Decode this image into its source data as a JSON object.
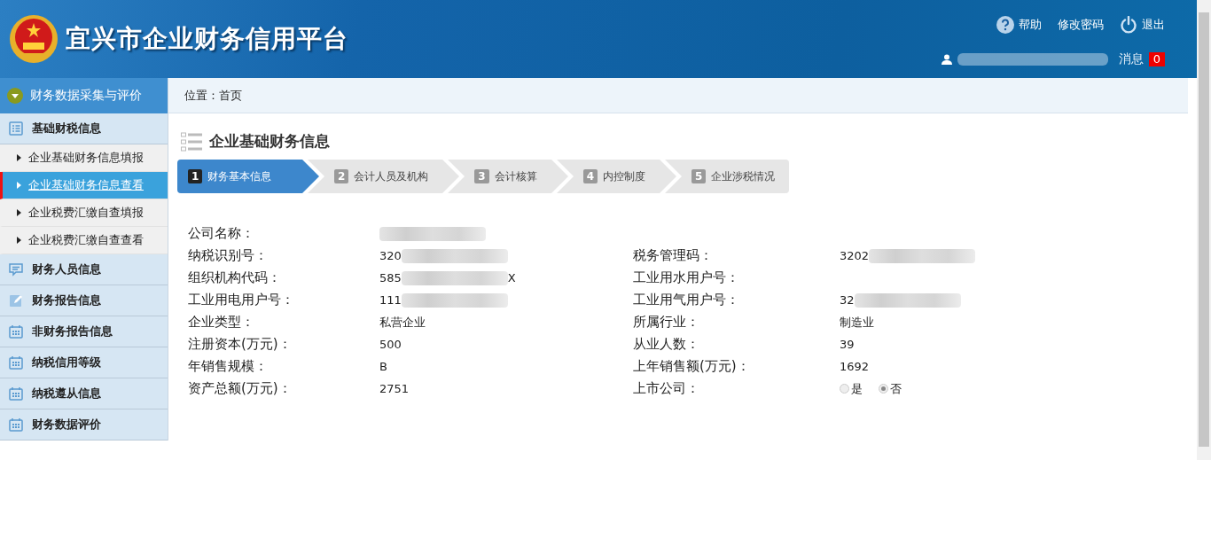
{
  "header": {
    "title": "宜兴市企业财务信用平台",
    "links": [
      {
        "kind": "help",
        "label": "帮助"
      },
      {
        "kind": "password",
        "label": "修改密码"
      },
      {
        "kind": "logout",
        "label": "退出"
      }
    ],
    "user": {
      "redacted": true
    },
    "messages": {
      "label": "消息",
      "count": "0"
    }
  },
  "sidebar": {
    "title": "财务数据采集与评价",
    "groups": [
      {
        "label": "基础财税信息",
        "children": [
          {
            "label": "企业基础财务信息填报",
            "selected": false
          },
          {
            "label": "企业基础财务信息查看",
            "selected": true
          },
          {
            "label": "企业税费汇缴自查填报",
            "selected": false
          },
          {
            "label": "企业税费汇缴自查查看",
            "selected": false
          }
        ]
      },
      {
        "label": "财务人员信息"
      },
      {
        "label": "财务报告信息"
      },
      {
        "label": "非财务报告信息"
      },
      {
        "label": "纳税信用等级"
      },
      {
        "label": "纳税遵从信息"
      },
      {
        "label": "财务数据评价"
      }
    ]
  },
  "breadcrumb": {
    "label": "位置：",
    "page": "首页"
  },
  "section_title": "企业基础财务信息",
  "steps": [
    {
      "number": "1",
      "label": "财务基本信息",
      "selected": true
    },
    {
      "number": "2",
      "label": "会计人员及机构",
      "selected": false
    },
    {
      "number": "3",
      "label": "会计核算",
      "selected": false
    },
    {
      "number": "4",
      "label": "内控制度",
      "selected": false
    },
    {
      "number": "5",
      "label": "企业涉税情况",
      "selected": false
    }
  ],
  "info_rows": [
    {
      "cells": [
        {
          "kind": "text",
          "label": "公司名称：",
          "redacted": true
        }
      ]
    },
    {
      "cells": [
        {
          "kind": "text",
          "label": "纳税识别号：",
          "value": "320",
          "redacted": true
        },
        {
          "kind": "text",
          "label": "税务管理码：",
          "value": "3202",
          "redacted": true
        }
      ]
    },
    {
      "cells": [
        {
          "kind": "text",
          "label": "组织机构代码：",
          "value": "585",
          "redacted": true,
          "suffix": "X"
        },
        {
          "kind": "text",
          "label": "工业用水用户号："
        }
      ]
    },
    {
      "cells": [
        {
          "kind": "text",
          "label": "工业用电用户号：",
          "value": "111",
          "redacted": true
        },
        {
          "kind": "text",
          "label": "工业用气用户号：",
          "value": "32",
          "redacted": true
        }
      ]
    },
    {
      "cells": [
        {
          "kind": "text",
          "label": "企业类型：",
          "value": "私营企业"
        },
        {
          "kind": "text",
          "label": "所属行业：",
          "value": "制造业"
        }
      ]
    },
    {
      "cells": [
        {
          "kind": "text",
          "label": "注册资本(万元)：",
          "value": "500"
        },
        {
          "kind": "text",
          "label": "从业人数：",
          "value": "39"
        }
      ]
    },
    {
      "cells": [
        {
          "kind": "text",
          "label": "年销售规模：",
          "value": "B"
        },
        {
          "kind": "text",
          "label": "上年销售额(万元)：",
          "value": "1692"
        }
      ]
    },
    {
      "cells": [
        {
          "kind": "text",
          "label": "资产总额(万元)：",
          "value": "2751"
        },
        {
          "kind": "radio",
          "label": "上市公司：",
          "options": [
            {
              "label": "是",
              "selected": false
            },
            {
              "label": "否",
              "selected": true
            }
          ]
        }
      ]
    }
  ]
}
